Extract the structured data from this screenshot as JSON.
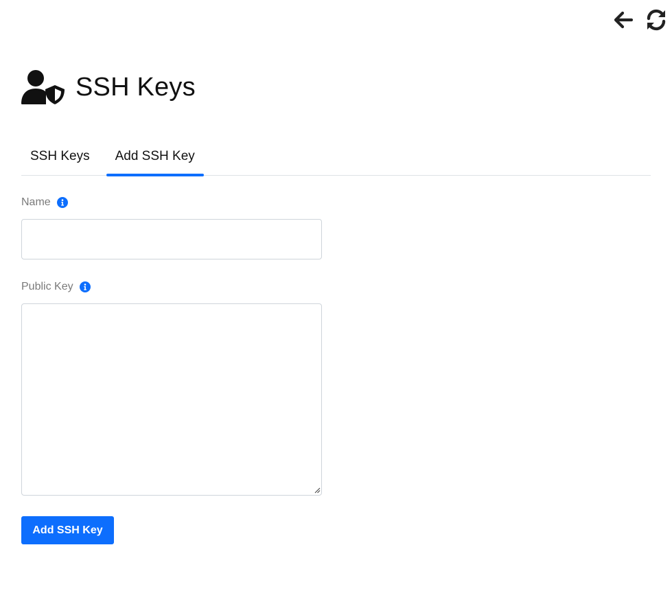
{
  "toolbar": {
    "back_icon": "arrow-left-icon",
    "refresh_icon": "refresh-icon"
  },
  "header": {
    "icon": "user-shield-icon",
    "title": "SSH Keys"
  },
  "tabs": [
    {
      "label": "SSH Keys",
      "active": false
    },
    {
      "label": "Add SSH Key",
      "active": true
    }
  ],
  "form": {
    "name": {
      "label": "Name",
      "value": "",
      "placeholder": ""
    },
    "public_key": {
      "label": "Public Key",
      "value": "",
      "placeholder": ""
    },
    "submit_label": "Add SSH Key"
  },
  "colors": {
    "accent": "#0d6efd",
    "label": "#7a7a7a",
    "border": "#ced4da",
    "divider": "#dee2e6"
  }
}
